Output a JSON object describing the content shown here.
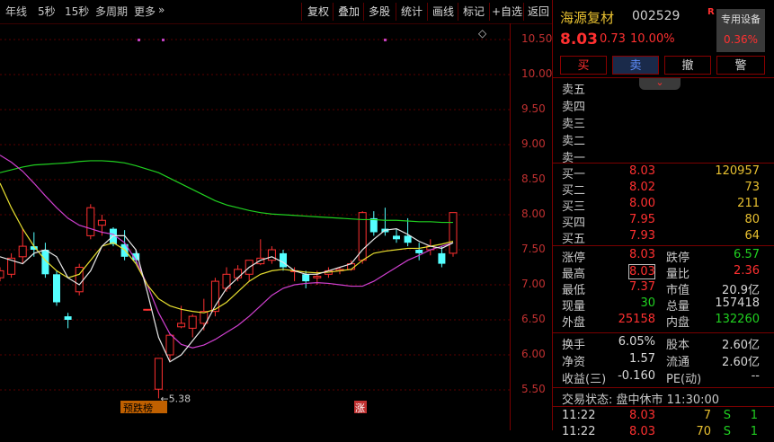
{
  "toolbar_left": [
    {
      "label": "年线",
      "name": "period-year"
    },
    {
      "label": "5秒",
      "name": "period-5s"
    },
    {
      "label": "15秒",
      "name": "period-15s"
    },
    {
      "label": "多周期",
      "name": "multi-period"
    },
    {
      "label": "更多",
      "name": "more-periods"
    }
  ],
  "more_arrow": "»",
  "toolbar_right": [
    {
      "label": "复权",
      "name": "adjust-button"
    },
    {
      "label": "叠加",
      "name": "overlay-button"
    },
    {
      "label": "多股",
      "name": "multi-stock-button"
    },
    {
      "label": "统计",
      "name": "stats-button"
    },
    {
      "label": "画线",
      "name": "draw-line-button"
    },
    {
      "label": "标记",
      "name": "mark-button"
    },
    {
      "label": "+自选",
      "name": "add-watchlist-button"
    },
    {
      "label": "返回",
      "name": "back-button"
    }
  ],
  "chart": {
    "y_ticks": [
      "10.50",
      "10.00",
      "9.50",
      "9.00",
      "8.50",
      "8.00",
      "7.50",
      "7.00",
      "6.50",
      "6.00",
      "5.50"
    ],
    "low_label": "5.38",
    "low_arrow": "←",
    "tag_drop": "预跌榜",
    "tag_rise": "涨",
    "collapse_icon": "◇",
    "candles": [
      {
        "o": 7.1,
        "h": 7.25,
        "l": 7.05,
        "c": 7.2
      },
      {
        "o": 7.15,
        "h": 7.45,
        "l": 7.1,
        "c": 7.38
      },
      {
        "o": 7.4,
        "h": 7.8,
        "l": 7.3,
        "c": 7.55
      },
      {
        "o": 7.55,
        "h": 7.75,
        "l": 7.4,
        "c": 7.5
      },
      {
        "o": 7.5,
        "h": 7.6,
        "l": 7.1,
        "c": 7.15
      },
      {
        "o": 7.15,
        "h": 7.2,
        "l": 6.7,
        "c": 6.75
      },
      {
        "o": 6.55,
        "h": 6.6,
        "l": 6.38,
        "c": 6.5
      },
      {
        "o": 6.9,
        "h": 7.3,
        "l": 6.85,
        "c": 7.25
      },
      {
        "o": 7.7,
        "h": 8.15,
        "l": 7.65,
        "c": 8.1
      },
      {
        "o": 7.85,
        "h": 8.0,
        "l": 7.7,
        "c": 7.92
      },
      {
        "o": 7.8,
        "h": 7.82,
        "l": 7.55,
        "c": 7.58
      },
      {
        "o": 7.58,
        "h": 7.78,
        "l": 7.35,
        "c": 7.4
      },
      {
        "o": 7.45,
        "h": 7.5,
        "l": 7.3,
        "c": 7.35
      },
      {
        "o": 6.64,
        "h": 6.65,
        "l": 6.63,
        "c": 6.65
      },
      {
        "o": 5.51,
        "h": 5.95,
        "l": 5.38,
        "c": 5.95
      },
      {
        "o": 6.0,
        "h": 6.3,
        "l": 5.92,
        "c": 6.28
      },
      {
        "o": 6.4,
        "h": 6.7,
        "l": 6.38,
        "c": 6.45
      },
      {
        "o": 6.38,
        "h": 6.58,
        "l": 6.25,
        "c": 6.55
      },
      {
        "o": 6.45,
        "h": 6.8,
        "l": 6.35,
        "c": 6.62
      },
      {
        "o": 6.62,
        "h": 7.1,
        "l": 6.55,
        "c": 7.05
      },
      {
        "o": 6.95,
        "h": 7.25,
        "l": 6.9,
        "c": 7.15
      },
      {
        "o": 7.1,
        "h": 7.28,
        "l": 7.05,
        "c": 7.22
      },
      {
        "o": 7.15,
        "h": 7.35,
        "l": 7.05,
        "c": 7.35
      },
      {
        "o": 7.3,
        "h": 7.65,
        "l": 7.28,
        "c": 7.38
      },
      {
        "o": 7.35,
        "h": 7.55,
        "l": 7.3,
        "c": 7.5
      },
      {
        "o": 7.45,
        "h": 7.5,
        "l": 7.2,
        "c": 7.25
      },
      {
        "o": 7.2,
        "h": 7.25,
        "l": 7.05,
        "c": 7.2
      },
      {
        "o": 7.15,
        "h": 7.2,
        "l": 6.95,
        "c": 7.05
      },
      {
        "o": 7.1,
        "h": 7.2,
        "l": 7.0,
        "c": 7.12
      },
      {
        "o": 7.15,
        "h": 7.25,
        "l": 7.1,
        "c": 7.2
      },
      {
        "o": 7.2,
        "h": 7.25,
        "l": 7.15,
        "c": 7.22
      },
      {
        "o": 7.22,
        "h": 7.35,
        "l": 7.2,
        "c": 7.3
      },
      {
        "o": 7.35,
        "h": 8.05,
        "l": 7.3,
        "c": 8.03
      },
      {
        "o": 7.95,
        "h": 8.05,
        "l": 7.7,
        "c": 7.75
      },
      {
        "o": 7.8,
        "h": 8.1,
        "l": 7.7,
        "c": 7.75
      },
      {
        "o": 7.7,
        "h": 7.8,
        "l": 7.6,
        "c": 7.65
      },
      {
        "o": 7.7,
        "h": 7.95,
        "l": 7.55,
        "c": 7.6
      },
      {
        "o": 7.5,
        "h": 7.6,
        "l": 7.35,
        "c": 7.45
      },
      {
        "o": 7.5,
        "h": 7.65,
        "l": 7.42,
        "c": 7.55
      },
      {
        "o": 7.45,
        "h": 7.55,
        "l": 7.25,
        "c": 7.3
      },
      {
        "o": 7.45,
        "h": 8.03,
        "l": 7.4,
        "c": 8.03
      }
    ],
    "ma_green": [
      8.6,
      8.64,
      8.68,
      8.71,
      8.72,
      8.73,
      8.74,
      8.76,
      8.77,
      8.77,
      8.76,
      8.74,
      8.7,
      8.65,
      8.6,
      8.52,
      8.44,
      8.36,
      8.28,
      8.2,
      8.14,
      8.1,
      8.06,
      8.03,
      8.01,
      8.0,
      7.99,
      7.98,
      7.97,
      7.96,
      7.95,
      7.94,
      7.93,
      7.93,
      7.92,
      7.92,
      7.91,
      7.9,
      7.9,
      7.89,
      7.89
    ],
    "ma_magenta": [
      8.85,
      8.75,
      8.62,
      8.45,
      8.27,
      8.1,
      7.95,
      7.85,
      7.8,
      7.75,
      7.72,
      7.6,
      7.35,
      7.0,
      6.6,
      6.3,
      6.15,
      6.1,
      6.14,
      6.22,
      6.32,
      6.42,
      6.55,
      6.7,
      6.85,
      6.95,
      7.0,
      7.02,
      7.03,
      7.02,
      7.0,
      6.98,
      6.98,
      7.05,
      7.15,
      7.25,
      7.35,
      7.42,
      7.5,
      7.55,
      7.6
    ],
    "ma_yellow": [
      8.45,
      8.1,
      7.8,
      7.55,
      7.35,
      7.2,
      7.1,
      7.15,
      7.35,
      7.55,
      7.6,
      7.5,
      7.3,
      7.0,
      6.8,
      6.7,
      6.65,
      6.62,
      6.6,
      6.65,
      6.75,
      6.9,
      7.05,
      7.15,
      7.2,
      7.22,
      7.2,
      7.18,
      7.17,
      7.18,
      7.2,
      7.22,
      7.35,
      7.45,
      7.48,
      7.5,
      7.52,
      7.52,
      7.55,
      7.58,
      7.62
    ],
    "ma_white": [
      7.4,
      7.35,
      7.3,
      7.45,
      7.5,
      7.4,
      7.1,
      7.0,
      7.2,
      7.55,
      7.7,
      7.7,
      7.5,
      6.9,
      6.25,
      5.9,
      6.0,
      6.2,
      6.4,
      6.7,
      6.95,
      7.1,
      7.25,
      7.35,
      7.4,
      7.32,
      7.2,
      7.15,
      7.15,
      7.2,
      7.25,
      7.3,
      7.5,
      7.65,
      7.78,
      7.8,
      7.72,
      7.62,
      7.55,
      7.52,
      7.6
    ]
  },
  "stock": {
    "name": "海源复材",
    "code": "002529",
    "badge": "R",
    "equip_label": "专用设备",
    "equip_value": "0.36%",
    "price": "8.03",
    "change": "0.73",
    "pct": "10.00%"
  },
  "trade_buttons": [
    {
      "label": "买",
      "name": "buy-button"
    },
    {
      "label": "卖",
      "name": "sell-button"
    },
    {
      "label": "撤",
      "name": "cancel-order-button"
    },
    {
      "label": "警",
      "name": "alert-button"
    }
  ],
  "collapse_arrow": "⌄",
  "sell_orders": [
    {
      "label": "卖五"
    },
    {
      "label": "卖四"
    },
    {
      "label": "卖三"
    },
    {
      "label": "卖二"
    },
    {
      "label": "卖一"
    }
  ],
  "buy_orders": [
    {
      "label": "买一",
      "price": "8.03",
      "vol": "120957"
    },
    {
      "label": "买二",
      "price": "8.02",
      "vol": "73"
    },
    {
      "label": "买三",
      "price": "8.00",
      "vol": "211"
    },
    {
      "label": "买四",
      "price": "7.95",
      "vol": "80"
    },
    {
      "label": "买五",
      "price": "7.93",
      "vol": "64"
    }
  ],
  "stats": [
    {
      "l1": "涨停",
      "v1": "8.03",
      "c1": "red",
      "l2": "跌停",
      "v2": "6.57",
      "c2": "grn"
    },
    {
      "l1": "最高",
      "v1": "8.03",
      "c1": "red",
      "l2": "量比",
      "v2": "2.36",
      "c2": "red"
    },
    {
      "l1": "最低",
      "v1": "7.37",
      "c1": "red",
      "l2": "市值",
      "v2": "20.9亿",
      "c2": "wht"
    },
    {
      "l1": "现量",
      "v1": "30",
      "c1": "grn",
      "l2": "总量",
      "v2": "157418",
      "c2": "wht"
    },
    {
      "l1": "外盘",
      "v1": "25158",
      "c1": "red",
      "l2": "内盘",
      "v2": "132260",
      "c2": "grn"
    }
  ],
  "fund": [
    {
      "l1": "换手",
      "v1": "6.05%",
      "l2": "股本",
      "v2": "2.60亿"
    },
    {
      "l1": "净资",
      "v1": "1.57",
      "l2": "流通",
      "v2": "2.60亿"
    },
    {
      "l1": "收益(三)",
      "v1": "-0.160",
      "l2": "PE(动)",
      "v2": "--"
    }
  ],
  "status": "交易状态: 盘中休市 11:30:00",
  "ticks": [
    {
      "time": "11:22",
      "price": "8.03",
      "vol": "7",
      "dir": "S",
      "n": "1"
    },
    {
      "time": "11:22",
      "price": "8.03",
      "vol": "70",
      "dir": "S",
      "n": "1"
    }
  ],
  "colors": {
    "up": "#ff3030",
    "down": "#54ffff",
    "grid": "#5a0000",
    "ma_green": "#20d020",
    "ma_magenta": "#d040d0",
    "ma_yellow": "#e8e030",
    "ma_white": "#e8e8e8"
  }
}
